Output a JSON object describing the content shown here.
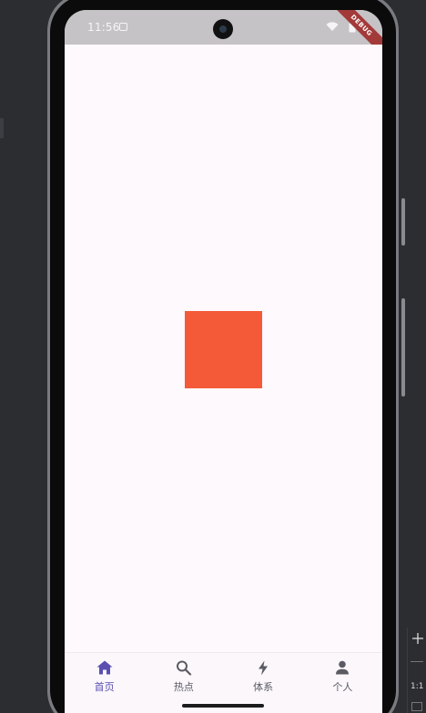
{
  "status_bar": {
    "time": "11:56"
  },
  "debug_banner": "DEBUG",
  "content": {
    "square_color": "#f45a37"
  },
  "bottom_nav": {
    "items": [
      {
        "label": "首页",
        "icon": "home-icon",
        "active": true
      },
      {
        "label": "热点",
        "icon": "search-icon",
        "active": false
      },
      {
        "label": "体系",
        "icon": "bolt-icon",
        "active": false
      },
      {
        "label": "个人",
        "icon": "person-icon",
        "active": false
      }
    ]
  },
  "emulator_tools": {
    "scale_label": "1:1"
  },
  "colors": {
    "accent": "#5a4fb0",
    "inactive": "#5b5b63",
    "screen_bg": "#fdf9fd",
    "status_bar_bg": "#c6c3c7"
  }
}
